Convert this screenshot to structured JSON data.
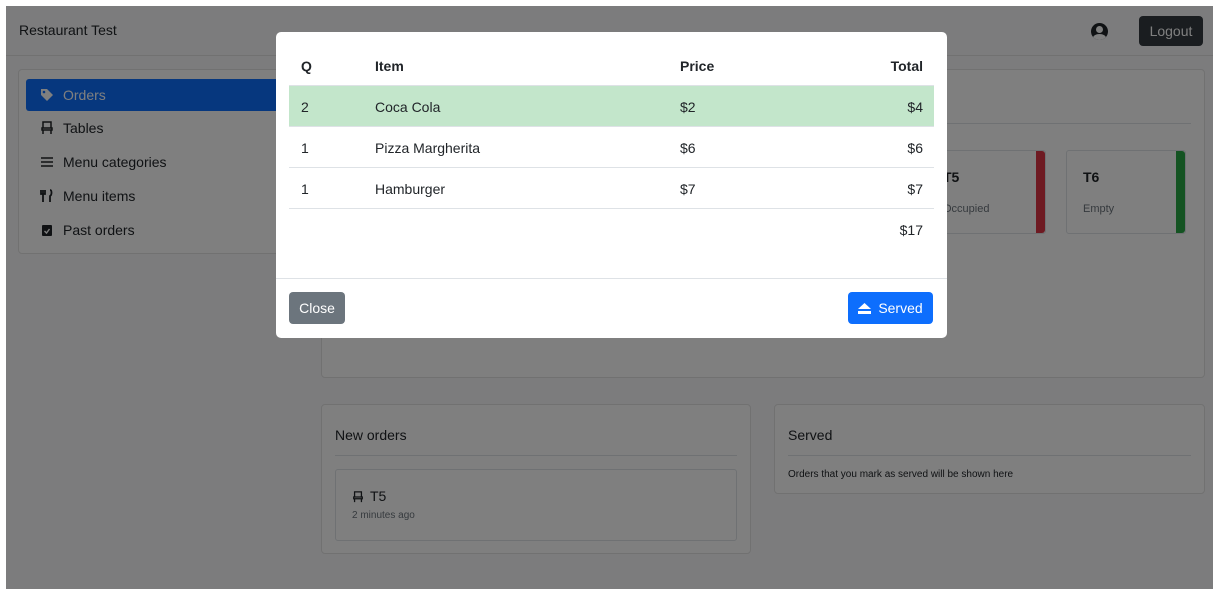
{
  "navbar": {
    "brand": "Restaurant Test",
    "user_icon": "user-circle-icon",
    "logout_label": "Logout"
  },
  "sidebar": {
    "items": [
      {
        "label": "Orders",
        "icon": "tag-icon",
        "active": true
      },
      {
        "label": "Tables",
        "icon": "chair-icon",
        "active": false
      },
      {
        "label": "Menu categories",
        "icon": "bars-icon",
        "active": false
      },
      {
        "label": "Menu items",
        "icon": "utensils-icon",
        "active": false
      },
      {
        "label": "Past orders",
        "icon": "clipboard-check-icon",
        "active": false
      }
    ]
  },
  "tables_panel": {
    "tables": [
      {
        "name": "T5",
        "status": "Occupied",
        "status_color": "#dc3545"
      },
      {
        "name": "T6",
        "status": "Empty",
        "status_color": "#28a745"
      }
    ]
  },
  "new_orders": {
    "title": "New orders",
    "orders": [
      {
        "table": "T5",
        "time": "2 minutes ago"
      }
    ]
  },
  "served": {
    "title": "Served",
    "empty_text": "Orders that you mark as served will be shown here"
  },
  "modal": {
    "headers": {
      "q": "Q",
      "item": "Item",
      "price": "Price",
      "total": "Total"
    },
    "rows": [
      {
        "q": "2",
        "item": "Coca Cola",
        "price": "$2",
        "total": "$4",
        "highlight": true
      },
      {
        "q": "1",
        "item": "Pizza Margherita",
        "price": "$6",
        "total": "$6",
        "highlight": false
      },
      {
        "q": "1",
        "item": "Hamburger",
        "price": "$7",
        "total": "$7",
        "highlight": false
      }
    ],
    "grand_total": "$17",
    "close_label": "Close",
    "served_label": "Served",
    "colors": {
      "highlight": "#c3e6cb",
      "primary": "#0d6efd",
      "secondary": "#6c757d"
    }
  }
}
